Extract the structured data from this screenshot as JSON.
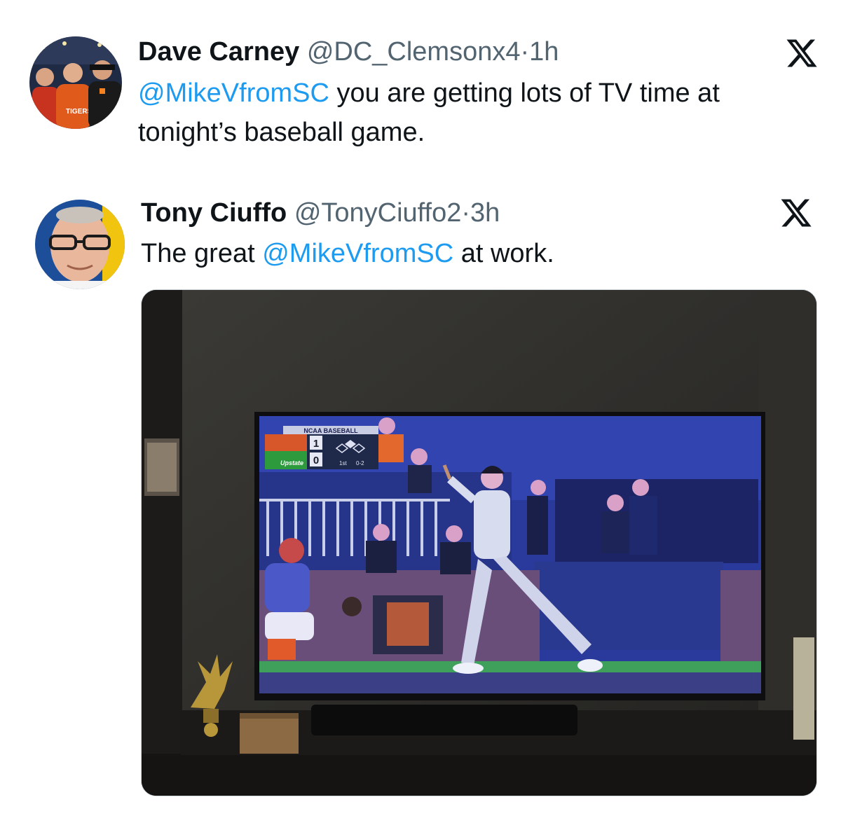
{
  "tweets": [
    {
      "name": "Dave Carney",
      "handle": "@DC_Clemsonx4",
      "separator": "·",
      "time": "1h",
      "mention": "@MikeVfromSC",
      "text_line1": " you are getting lots of TV time at",
      "text_line2": "tonight’s baseball game.",
      "avatar_icon": "group-photo-avatar",
      "platform_icon": "x-logo-icon"
    },
    {
      "name": "Tony Ciuffo",
      "handle": "@TonyCiuffo2",
      "separator": "·",
      "time": "3h",
      "text_prefix": "The great ",
      "mention": "@MikeVfromSC",
      "text_suffix": " at work.",
      "avatar_icon": "man-with-glasses-avatar",
      "platform_icon": "x-logo-icon",
      "media": {
        "description_icon": "tv-baseball-photo",
        "scoreboard": {
          "league": "NCAA BASEBALL",
          "top_score": "1",
          "bottom_score": "0",
          "inning": "1st",
          "count": "0-2",
          "bottom_team": "Upstate"
        }
      }
    }
  ],
  "colors": {
    "mention": "#1d9bf0",
    "secondary_text": "#536471",
    "primary_text": "#0f1419"
  }
}
